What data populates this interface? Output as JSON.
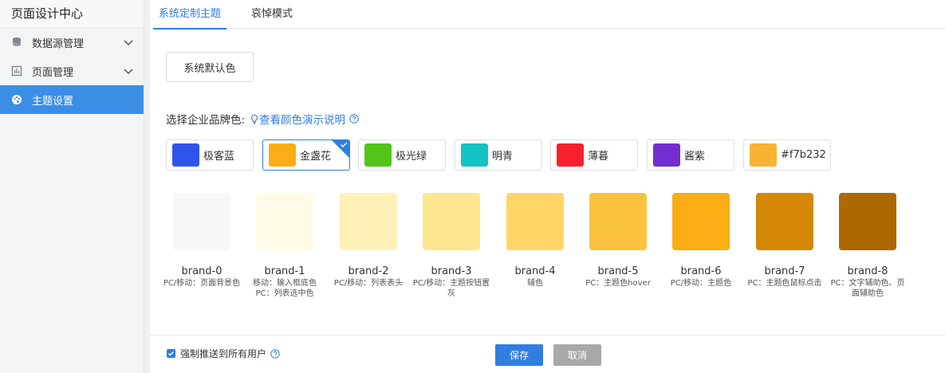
{
  "sidebar": {
    "title": "页面设计中心",
    "items": [
      {
        "label": "数据源管理",
        "icon": "database-icon"
      },
      {
        "label": "页面管理",
        "icon": "chart-icon"
      },
      {
        "label": "主题设置",
        "icon": "palette-icon"
      }
    ]
  },
  "tabs": [
    {
      "label": "系统定制主题"
    },
    {
      "label": "哀悼模式"
    }
  ],
  "main": {
    "default_color_label": "系统默认色",
    "brand_label": "选择企业品牌色:",
    "demo_link": "查看颜色演示说明"
  },
  "swatches": [
    {
      "name": "极客蓝",
      "color": "#2f54eb"
    },
    {
      "name": "金盏花",
      "color": "#faad14",
      "selected": true
    },
    {
      "name": "极光绿",
      "color": "#52c41a"
    },
    {
      "name": "明青",
      "color": "#13c2c2"
    },
    {
      "name": "薄暮",
      "color": "#f5222d"
    },
    {
      "name": "酱紫",
      "color": "#722ed1"
    },
    {
      "name": "#f7b232",
      "color": "#f7b232"
    }
  ],
  "shades": [
    {
      "name": "brand-0",
      "desc": "PC/移动：页面背景色",
      "color": "#f8f8f8"
    },
    {
      "name": "brand-1",
      "desc": "移动：输入框底色 PC：列表选中色",
      "color": "#fffbe6"
    },
    {
      "name": "brand-2",
      "desc": "PC/移动：列表表头",
      "color": "#fff1b8"
    },
    {
      "name": "brand-3",
      "desc": "PC/移动：主题按钮置灰",
      "color": "#ffe58f"
    },
    {
      "name": "brand-4",
      "desc": "辅色",
      "color": "#ffd666"
    },
    {
      "name": "brand-5",
      "desc": "PC：主题色hover",
      "color": "#fbc23f"
    },
    {
      "name": "brand-6",
      "desc": "PC/移动：主题色",
      "color": "#faad14"
    },
    {
      "name": "brand-7",
      "desc": "PC：主题色鼠标点击",
      "color": "#d48806"
    },
    {
      "name": "brand-8",
      "desc": "PC：文字辅助色、页面辅助色",
      "color": "#ad6800"
    }
  ],
  "footer": {
    "force_push_label": "强制推送到所有用户",
    "save_label": "保存",
    "cancel_label": "取消"
  }
}
